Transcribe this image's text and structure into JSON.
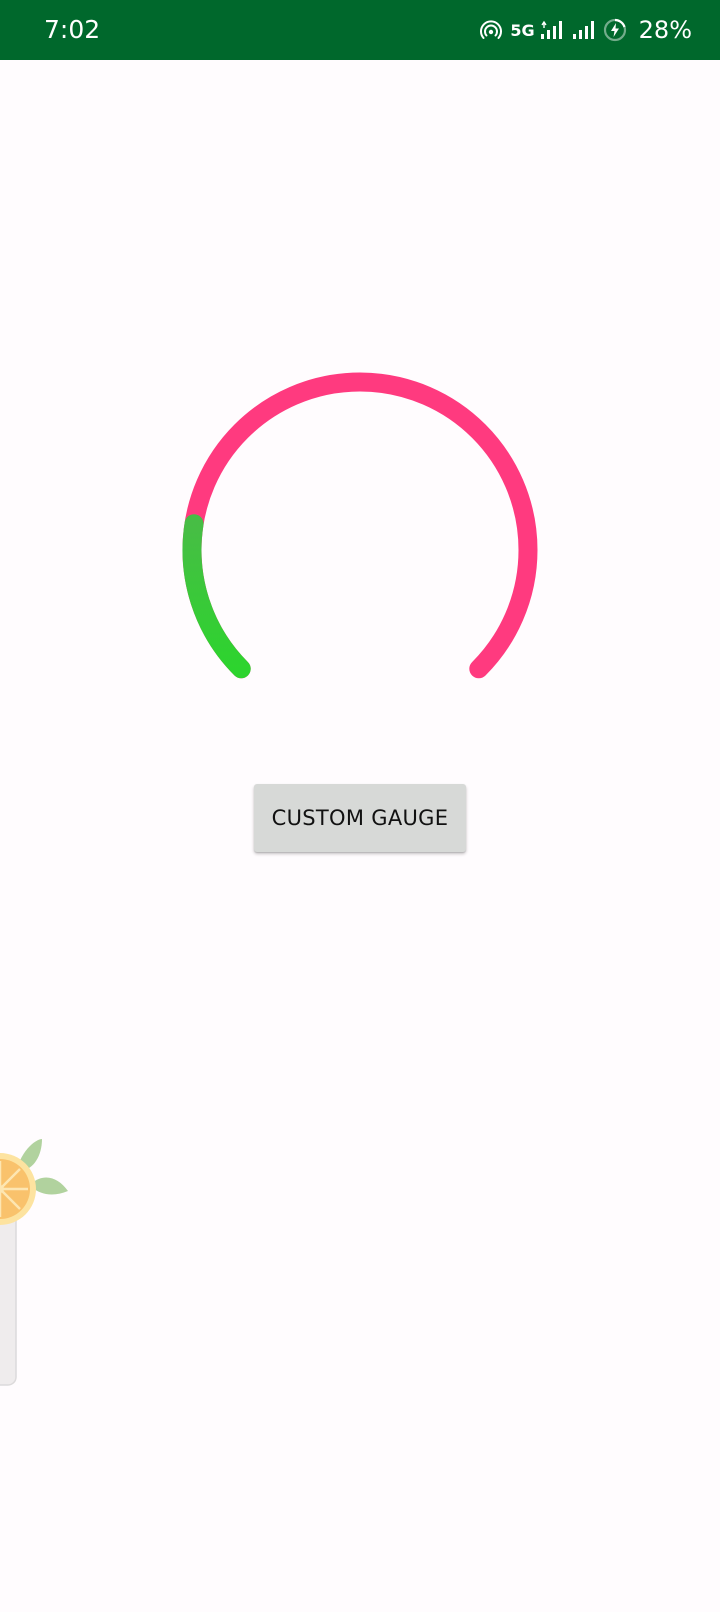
{
  "status_bar": {
    "time": "7:02",
    "network_label": "5G",
    "battery_percent": "28%",
    "icons": [
      "hotspot-icon",
      "signal-icon",
      "signal-icon",
      "battery-charging-icon"
    ],
    "background_color": "#00682c"
  },
  "gauge": {
    "value_fraction": 0.2,
    "low_color": "#3ed23a",
    "high_color": "#ff3a7f"
  },
  "main": {
    "button_label": "CUSTOM GAUGE"
  },
  "floating_widget": {
    "icon": "orange-slice-icon"
  }
}
